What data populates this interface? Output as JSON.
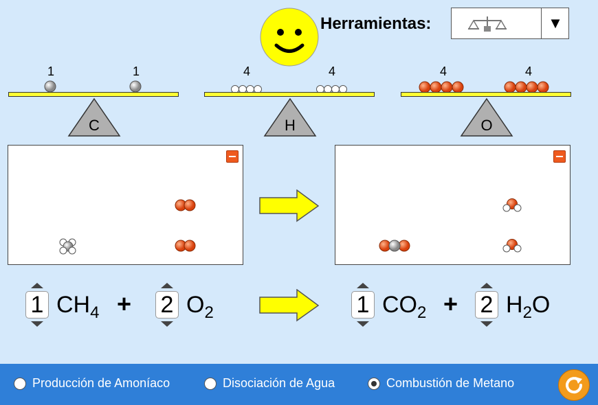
{
  "tools": {
    "label": "Herramientas:",
    "selected_icon": "balance-scale-icon",
    "dropdown_icon": "triangle-down-icon"
  },
  "balances": [
    {
      "element": "C",
      "left_count": "1",
      "right_count": "1"
    },
    {
      "element": "H",
      "left_count": "4",
      "right_count": "4"
    },
    {
      "element": "O",
      "left_count": "4",
      "right_count": "4"
    }
  ],
  "equation": {
    "reactants": [
      {
        "coefficient": "1",
        "formula": "CH",
        "subscript": "4"
      },
      {
        "coefficient": "2",
        "formula": "O",
        "subscript": "2"
      }
    ],
    "products": [
      {
        "coefficient": "1",
        "formula_pre": "CO",
        "subscript": "2",
        "formula_post": ""
      },
      {
        "coefficient": "2",
        "formula_pre": "H",
        "subscript": "2",
        "formula_post": "O"
      }
    ],
    "plus": "+"
  },
  "footer": {
    "options": [
      {
        "label": "Producción de Amoníaco",
        "selected": false
      },
      {
        "label": "Disociación de Agua",
        "selected": false
      },
      {
        "label": "Combustión de Metano",
        "selected": true
      }
    ],
    "reset_icon": "reset-icon"
  },
  "colors": {
    "background": "#d5e9fb",
    "beam": "#ffff33",
    "oxygen": "#ef5a1e",
    "carbon": "#9a9a9a",
    "hydrogen": "#ffffff",
    "footer": "#2f7fd8",
    "smiley": "#ffff00",
    "arrow": "#ffff00"
  }
}
